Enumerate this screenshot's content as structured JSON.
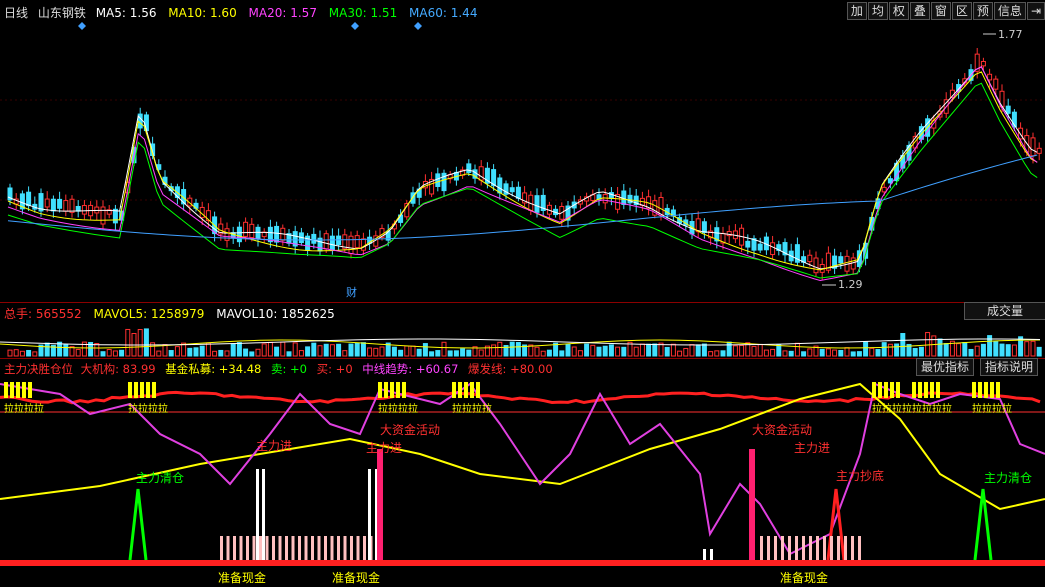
{
  "header": {
    "period": "日线",
    "stock": "山东钢铁",
    "ma": [
      {
        "label": "MA5: 1.56",
        "color": "#ffffff"
      },
      {
        "label": "MA10: 1.60",
        "color": "#ffff00"
      },
      {
        "label": "MA20: 1.57",
        "color": "#ff40ff"
      },
      {
        "label": "MA30: 1.51",
        "color": "#00ff00"
      },
      {
        "label": "MA60: 1.44",
        "color": "#40a0ff"
      }
    ],
    "toolbar": [
      "加",
      "均",
      "权",
      "叠",
      "窗",
      "区",
      "预",
      "信息",
      "⇥"
    ]
  },
  "price_chart": {
    "high_label": "1.77",
    "low_label": "1.29",
    "marker_label": "财"
  },
  "volume_panel": {
    "total": {
      "label": "总手:",
      "value": "565552"
    },
    "mavol5": {
      "label": "MAVOL5:",
      "value": "1258979"
    },
    "mavol10": {
      "label": "MAVOL10:",
      "value": "1852625"
    },
    "button": "成交量"
  },
  "indicator_panel": {
    "items": [
      {
        "label": "主力决胜仓位",
        "color": "#ff3030"
      },
      {
        "label": "大机构: 83.99",
        "color": "#ff3030"
      },
      {
        "label": "基金私募: +34.48",
        "color": "#ffff00"
      },
      {
        "label": "卖: +0",
        "color": "#00ff00"
      },
      {
        "label": "买: +0",
        "color": "#ff3030"
      },
      {
        "label": "中线趋势: +60.67",
        "color": "#ff40ff"
      },
      {
        "label": "爆发线: +80.00",
        "color": "#ff3030"
      }
    ],
    "btn_best": "最优指标",
    "btn_help": "指标说明",
    "annotations": [
      {
        "text": "主力清仓",
        "color": "#00ff00"
      },
      {
        "text": "主力进",
        "color": "#ff3030"
      },
      {
        "text": "大资金活动",
        "color": "#ff3030"
      },
      {
        "text": "主力进",
        "color": "#ff3030"
      },
      {
        "text": "大资金活动",
        "color": "#ff3030"
      },
      {
        "text": "主力进",
        "color": "#ff3030"
      },
      {
        "text": "主力抄底",
        "color": "#ff3030"
      },
      {
        "text": "主力清仓",
        "color": "#00ff00"
      },
      {
        "text": "准备现金",
        "color": "#ffff00"
      },
      {
        "text": "准备现金",
        "color": "#ffff00"
      },
      {
        "text": "准备现金",
        "color": "#ffff00"
      }
    ],
    "pull_label": "拉"
  }
}
